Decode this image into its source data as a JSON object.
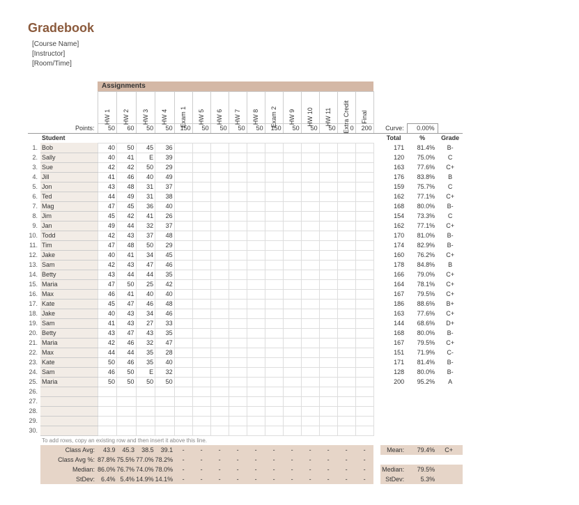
{
  "title": "Gradebook",
  "meta": {
    "course": "[Course Name]",
    "instructor": "[Instructor]",
    "room": "[Room/Time]"
  },
  "assignments_label": "Assignments",
  "assignments": [
    "HW 1",
    "HW 2",
    "HW 3",
    "HW 4",
    "Exam 1",
    "HW 5",
    "HW 6",
    "HW 7",
    "HW 8",
    "Exam 2",
    "HW 9",
    "HW 10",
    "HW 11",
    "Extra Credit",
    "Final"
  ],
  "points_label": "Points:",
  "points": [
    "50",
    "60",
    "50",
    "50",
    "150",
    "50",
    "50",
    "50",
    "50",
    "150",
    "50",
    "50",
    "50",
    "0",
    "200"
  ],
  "student_label": "Student",
  "curve_label": "Curve:",
  "curve_value": "0.00%",
  "summary_headers": {
    "total": "Total",
    "pct": "%",
    "grade": "Grade"
  },
  "students": [
    {
      "n": "1.",
      "name": "Bob",
      "s": [
        "40",
        "50",
        "45",
        "36"
      ],
      "t": "171",
      "p": "81.4%",
      "g": "B-"
    },
    {
      "n": "2.",
      "name": "Sally",
      "s": [
        "40",
        "41",
        "E",
        "39"
      ],
      "t": "120",
      "p": "75.0%",
      "g": "C"
    },
    {
      "n": "3.",
      "name": "Sue",
      "s": [
        "42",
        "42",
        "50",
        "29"
      ],
      "t": "163",
      "p": "77.6%",
      "g": "C+"
    },
    {
      "n": "4.",
      "name": "Jill",
      "s": [
        "41",
        "46",
        "40",
        "49"
      ],
      "t": "176",
      "p": "83.8%",
      "g": "B"
    },
    {
      "n": "5.",
      "name": "Jon",
      "s": [
        "43",
        "48",
        "31",
        "37"
      ],
      "t": "159",
      "p": "75.7%",
      "g": "C"
    },
    {
      "n": "6.",
      "name": "Ted",
      "s": [
        "44",
        "49",
        "31",
        "38"
      ],
      "t": "162",
      "p": "77.1%",
      "g": "C+"
    },
    {
      "n": "7.",
      "name": "Mag",
      "s": [
        "47",
        "45",
        "36",
        "40"
      ],
      "t": "168",
      "p": "80.0%",
      "g": "B-"
    },
    {
      "n": "8.",
      "name": "Jim",
      "s": [
        "45",
        "42",
        "41",
        "26"
      ],
      "t": "154",
      "p": "73.3%",
      "g": "C"
    },
    {
      "n": "9.",
      "name": "Jan",
      "s": [
        "49",
        "44",
        "32",
        "37"
      ],
      "t": "162",
      "p": "77.1%",
      "g": "C+"
    },
    {
      "n": "10.",
      "name": "Todd",
      "s": [
        "42",
        "43",
        "37",
        "48"
      ],
      "t": "170",
      "p": "81.0%",
      "g": "B-"
    },
    {
      "n": "11.",
      "name": "Tim",
      "s": [
        "47",
        "48",
        "50",
        "29"
      ],
      "t": "174",
      "p": "82.9%",
      "g": "B-"
    },
    {
      "n": "12.",
      "name": "Jake",
      "s": [
        "40",
        "41",
        "34",
        "45"
      ],
      "t": "160",
      "p": "76.2%",
      "g": "C+"
    },
    {
      "n": "13.",
      "name": "Sam",
      "s": [
        "42",
        "43",
        "47",
        "46"
      ],
      "t": "178",
      "p": "84.8%",
      "g": "B"
    },
    {
      "n": "14.",
      "name": "Betty",
      "s": [
        "43",
        "44",
        "44",
        "35"
      ],
      "t": "166",
      "p": "79.0%",
      "g": "C+"
    },
    {
      "n": "15.",
      "name": "Maria",
      "s": [
        "47",
        "50",
        "25",
        "42"
      ],
      "t": "164",
      "p": "78.1%",
      "g": "C+"
    },
    {
      "n": "16.",
      "name": "Max",
      "s": [
        "46",
        "41",
        "40",
        "40"
      ],
      "t": "167",
      "p": "79.5%",
      "g": "C+"
    },
    {
      "n": "17.",
      "name": "Kate",
      "s": [
        "45",
        "47",
        "46",
        "48"
      ],
      "t": "186",
      "p": "88.6%",
      "g": "B+"
    },
    {
      "n": "18.",
      "name": "Jake",
      "s": [
        "40",
        "43",
        "34",
        "46"
      ],
      "t": "163",
      "p": "77.6%",
      "g": "C+"
    },
    {
      "n": "19.",
      "name": "Sam",
      "s": [
        "41",
        "43",
        "27",
        "33"
      ],
      "t": "144",
      "p": "68.6%",
      "g": "D+"
    },
    {
      "n": "20.",
      "name": "Betty",
      "s": [
        "43",
        "47",
        "43",
        "35"
      ],
      "t": "168",
      "p": "80.0%",
      "g": "B-"
    },
    {
      "n": "21.",
      "name": "Maria",
      "s": [
        "42",
        "46",
        "32",
        "47"
      ],
      "t": "167",
      "p": "79.5%",
      "g": "C+"
    },
    {
      "n": "22.",
      "name": "Max",
      "s": [
        "44",
        "44",
        "35",
        "28"
      ],
      "t": "151",
      "p": "71.9%",
      "g": "C-"
    },
    {
      "n": "23.",
      "name": "Kate",
      "s": [
        "50",
        "46",
        "35",
        "40"
      ],
      "t": "171",
      "p": "81.4%",
      "g": "B-"
    },
    {
      "n": "24.",
      "name": "Sam",
      "s": [
        "46",
        "50",
        "E",
        "32"
      ],
      "t": "128",
      "p": "80.0%",
      "g": "B-"
    },
    {
      "n": "25.",
      "name": "Maria",
      "s": [
        "50",
        "50",
        "50",
        "50"
      ],
      "t": "200",
      "p": "95.2%",
      "g": "A"
    }
  ],
  "blank_rows": [
    "26.",
    "27.",
    "28.",
    "29.",
    "30."
  ],
  "footnote": "To add rows, copy an existing row and then insert it above this line.",
  "stats": {
    "class_avg": {
      "label": "Class Avg:",
      "vals": [
        "43.9",
        "45.3",
        "38.5",
        "39.1"
      ]
    },
    "class_avg_pct": {
      "label": "Class Avg %:",
      "vals": [
        "87.8%",
        "75.5%",
        "77.0%",
        "78.2%"
      ]
    },
    "median": {
      "label": "Median:",
      "vals": [
        "86.0%",
        "76.7%",
        "74.0%",
        "78.0%"
      ]
    },
    "stdev": {
      "label": "StDev:",
      "vals": [
        "6.4%",
        "5.4%",
        "14.9%",
        "14.1%"
      ]
    }
  },
  "right_stats": {
    "mean": {
      "label": "Mean:",
      "val": "79.4%",
      "g": "C+"
    },
    "median": {
      "label": "Median:",
      "val": "79.5%"
    },
    "stdev": {
      "label": "StDev:",
      "val": "5.3%"
    }
  }
}
